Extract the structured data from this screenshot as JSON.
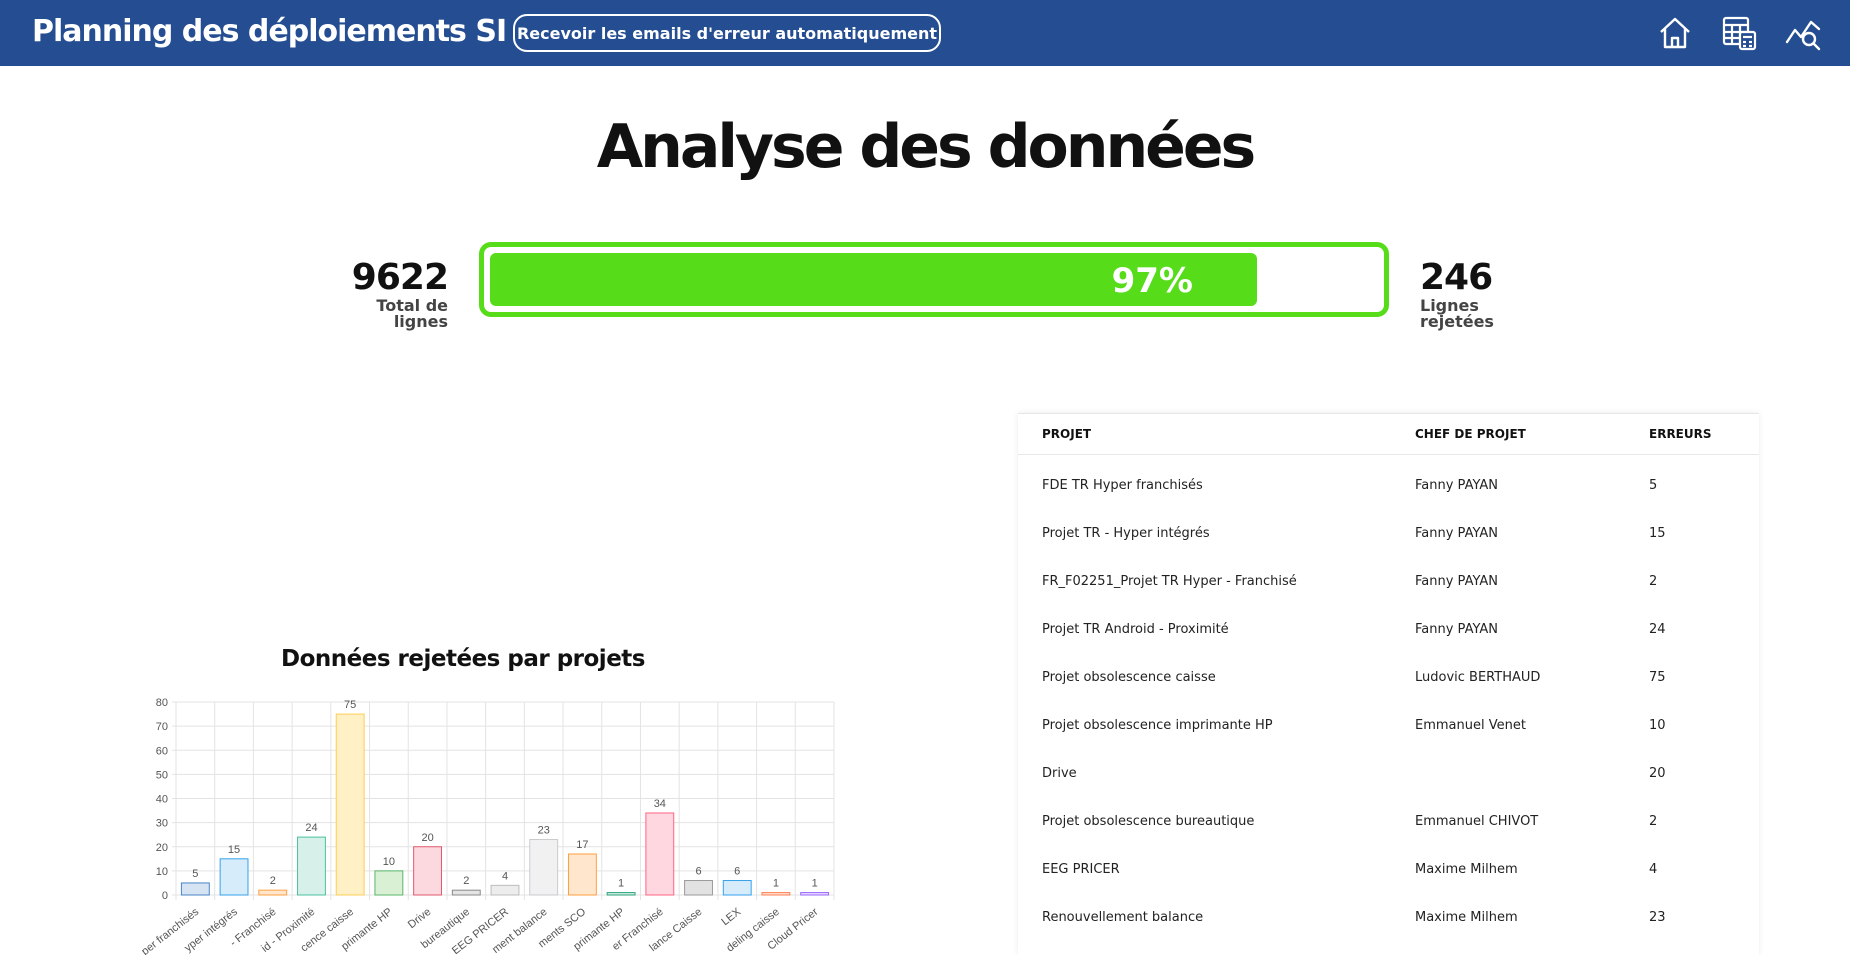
{
  "header": {
    "title": "Planning des déploiements SI",
    "email_button": "Recevoir les emails d'erreur automatiquement",
    "nav_icons": [
      "home-icon",
      "table-calculator-icon",
      "chart-search-icon"
    ],
    "bg_color": "#254e92"
  },
  "page": {
    "title": "Analyse des données"
  },
  "stats": {
    "total_value": "9622",
    "total_label": "Total de lignes",
    "rejected_value": "246",
    "rejected_label": "Lignes rejetées",
    "progress_text": "97%",
    "progress_fraction": 0.97,
    "progress_color": "#56dc18"
  },
  "chart_data": {
    "type": "bar",
    "title": "Données rejetées par projets",
    "categories": [
      "FDE TR Hyper franchisés",
      "Projet TR - Hyper intégrés",
      "FR_F02251_Projet TR Hyper - Franchisé",
      "Projet TR Android - Proximité",
      "Projet obsolescence caisse",
      "Projet obsolescence imprimante HP",
      "Drive",
      "Projet obsolescence bureautique",
      "EEG PRICER",
      "Renouvellement balance",
      "Déploiements SCO",
      "Projet obsolescence imprimante HP",
      "Hyper Franchisé",
      "Balance Caisse",
      "LEX",
      "Modeling caisse",
      "Cloud Pricer"
    ],
    "tick_labels": [
      "per franchisés",
      "yper intégrés",
      "- Franchisé",
      "id - Proximité",
      "cence caisse",
      "primante HP",
      "Drive",
      "bureautique",
      "EEG PRICER",
      "ment balance",
      "ments SCO",
      "primante HP",
      "er Franchisé",
      "lance Caisse",
      "LEX",
      "deling caisse",
      "Cloud Pricer"
    ],
    "values": [
      5,
      15,
      2,
      24,
      75,
      10,
      20,
      2,
      4,
      23,
      17,
      1,
      34,
      6,
      6,
      1,
      1
    ],
    "colors": [
      "#4a86c8",
      "#36a2eb",
      "#ff9f40",
      "#4bc0a0",
      "#ffcd56",
      "#5ab56a",
      "#e05a6e",
      "#8a8a8a",
      "#bdbdbd",
      "#c9cbcf",
      "#ff9f40",
      "#2aa37a",
      "#ff6384",
      "#9a9a9a",
      "#36a2eb",
      "#ff7f50",
      "#9966ff"
    ],
    "fills": [
      "#d5e3f2",
      "#d6ecfb",
      "#ffe6cc",
      "#d7f0e9",
      "#fff0c5",
      "#d9f0d5",
      "#fbd9df",
      "#e4e4e4",
      "#ededed",
      "#f1f1f2",
      "#ffe6cc",
      "#d3eee4",
      "#ffd7e0",
      "#e2e2e2",
      "#d6ecfb",
      "#ffe0d4",
      "#e8dcff"
    ],
    "ylim": [
      0,
      80
    ],
    "yticks": [
      0,
      10,
      20,
      30,
      40,
      50,
      60,
      70,
      80
    ],
    "grid": true
  },
  "table": {
    "headers": [
      "PROJET",
      "CHEF DE PROJET",
      "ERREURS"
    ],
    "rows": [
      {
        "projet": "FDE TR Hyper franchisés",
        "chef": "Fanny PAYAN",
        "erreurs": "5"
      },
      {
        "projet": "Projet TR - Hyper intégrés",
        "chef": "Fanny PAYAN",
        "erreurs": "15"
      },
      {
        "projet": "FR_F02251_Projet TR Hyper - Franchisé",
        "chef": "Fanny PAYAN",
        "erreurs": "2"
      },
      {
        "projet": "Projet TR Android - Proximité",
        "chef": "Fanny PAYAN",
        "erreurs": "24"
      },
      {
        "projet": "Projet obsolescence caisse",
        "chef": "Ludovic BERTHAUD",
        "erreurs": "75"
      },
      {
        "projet": "Projet obsolescence imprimante HP",
        "chef": "Emmanuel Venet",
        "erreurs": "10"
      },
      {
        "projet": "Drive",
        "chef": "",
        "erreurs": "20"
      },
      {
        "projet": "Projet obsolescence bureautique",
        "chef": "Emmanuel CHIVOT",
        "erreurs": "2"
      },
      {
        "projet": "EEG PRICER",
        "chef": "Maxime Milhem",
        "erreurs": "4"
      },
      {
        "projet": "Renouvellement balance",
        "chef": "Maxime Milhem",
        "erreurs": "23"
      }
    ]
  }
}
